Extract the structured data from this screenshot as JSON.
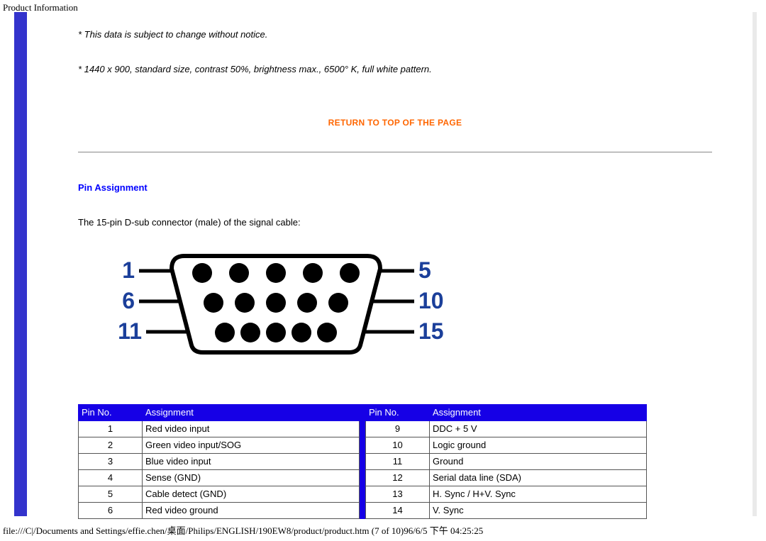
{
  "page": {
    "header": "Product Information",
    "footer": "file:///C|/Documents and Settings/effie.chen/桌面/Philips/ENGLISH/190EW8/product/product.htm (7 of 10)96/6/5 下午 04:25:25"
  },
  "notes": {
    "n1": "* This data is subject to change without notice.",
    "n2": "* 1440 x 900, standard size, contrast 50%, brightness max., 6500° K, full white pattern."
  },
  "return_link": "RETURN TO TOP OF THE PAGE",
  "section": {
    "title": "Pin Assignment",
    "desc": "The 15-pin D-sub connector (male) of the signal cable:"
  },
  "diagram": {
    "labels": {
      "l1": "1",
      "l2": "6",
      "l3": "11",
      "r1": "5",
      "r2": "10",
      "r3": "15"
    }
  },
  "table": {
    "headers": {
      "pin": "Pin No.",
      "assign": "Assignment"
    },
    "left": [
      {
        "pin": "1",
        "assign": "Red video input"
      },
      {
        "pin": "2",
        "assign": "Green video input/SOG"
      },
      {
        "pin": "3",
        "assign": "Blue video input"
      },
      {
        "pin": "4",
        "assign": "Sense (GND)"
      },
      {
        "pin": "5",
        "assign": "Cable detect (GND)"
      },
      {
        "pin": "6",
        "assign": "Red video ground"
      }
    ],
    "right": [
      {
        "pin": "9",
        "assign": "DDC + 5 V"
      },
      {
        "pin": "10",
        "assign": "Logic ground"
      },
      {
        "pin": "11",
        "assign": "Ground"
      },
      {
        "pin": "12",
        "assign": "Serial data line (SDA)"
      },
      {
        "pin": "13",
        "assign": "H. Sync / H+V. Sync"
      },
      {
        "pin": "14",
        "assign": "V. Sync"
      }
    ]
  }
}
